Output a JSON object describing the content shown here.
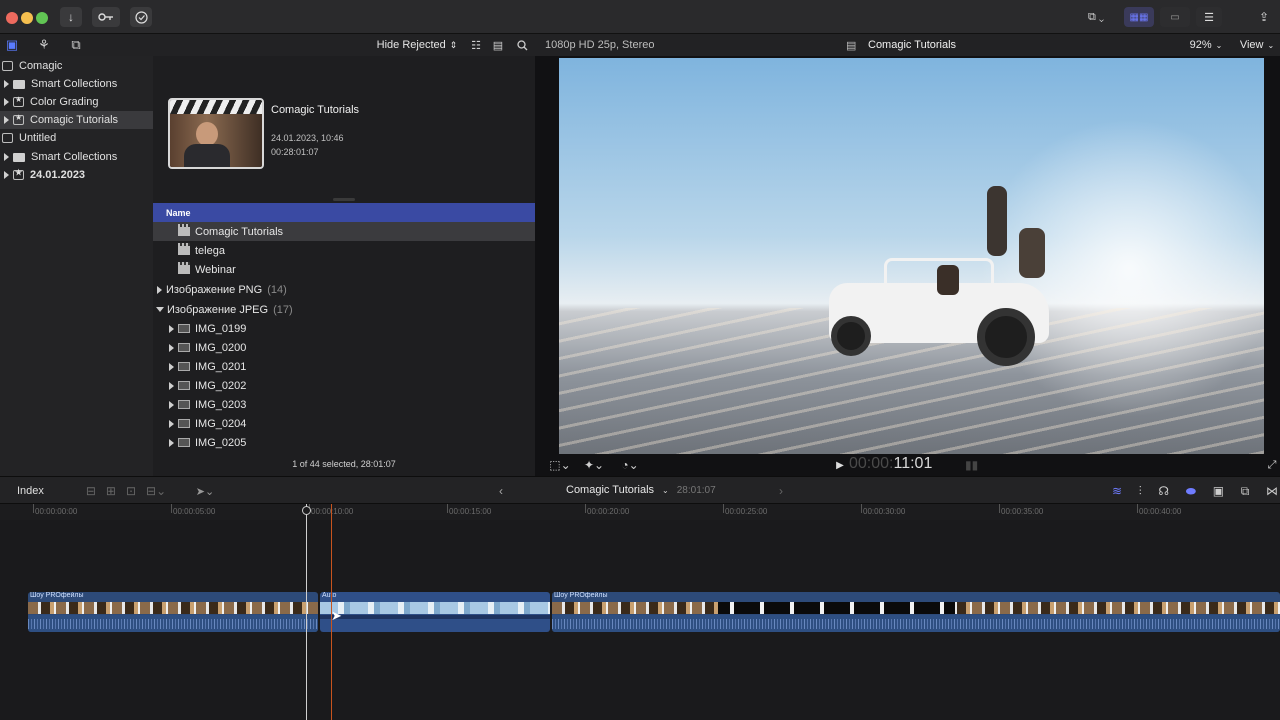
{
  "window": {
    "traffic_lights": [
      "#ed6a5e",
      "#f5bf4f",
      "#61c554"
    ]
  },
  "toolbar": {
    "import_icon": "download-icon",
    "keywords_icon": "key-icon",
    "background_tasks_icon": "checkmark-circle-icon"
  },
  "sidebar": {
    "items": [
      {
        "label": "Comagic",
        "kind": "library",
        "level": 0
      },
      {
        "label": "Smart Collections",
        "kind": "folder",
        "level": 1
      },
      {
        "label": "Color Grading",
        "kind": "event",
        "level": 1
      },
      {
        "label": "Comagic Tutorials",
        "kind": "event",
        "level": 1,
        "selected": true
      },
      {
        "label": "Untitled",
        "kind": "library",
        "level": 0
      },
      {
        "label": "Smart Collections",
        "kind": "folder",
        "level": 1
      },
      {
        "label": "24.01.2023",
        "kind": "event",
        "level": 1
      }
    ]
  },
  "browser": {
    "filter": "Hide Rejected",
    "project": {
      "title": "Comagic Tutorials",
      "date": "24.01.2023, 10:46",
      "duration": "00:28:01:07"
    },
    "column_name": "Name",
    "rows": [
      {
        "label": "Comagic Tutorials",
        "icon": "clapper",
        "selected": true
      },
      {
        "label": "telega",
        "icon": "clapper"
      },
      {
        "label": "Webinar",
        "icon": "clapper"
      }
    ],
    "groups": [
      {
        "label": "Изображение PNG",
        "count": "(14)",
        "open": false
      },
      {
        "label": "Изображение JPEG",
        "count": "(17)",
        "open": true
      }
    ],
    "images": [
      "IMG_0199",
      "IMG_0200",
      "IMG_0201",
      "IMG_0202",
      "IMG_0203",
      "IMG_0204",
      "IMG_0205"
    ],
    "status": "1 of 44 selected, 28:01:07"
  },
  "viewer": {
    "format": "1080p HD 25p, Stereo",
    "title": "Comagic Tutorials",
    "zoom": "92%",
    "view_label": "View",
    "timecode_dim": "00:00:",
    "timecode": "11:01"
  },
  "timeline": {
    "index_label": "Index",
    "project": "Comagic Tutorials",
    "duration": "28:01:07",
    "ticks": [
      "00:00:00:00",
      "00:00:05:00",
      "00:00:10:00",
      "00:00:15:00",
      "00:00:20:00",
      "00:00:25:00",
      "00:00:30:00",
      "00:00:35:00",
      "00:00:40:00"
    ],
    "clips": [
      {
        "label": "Шоу PROфейлы"
      },
      {
        "label": "Auto"
      },
      {
        "label": "Шоу PROфейлы"
      }
    ]
  }
}
